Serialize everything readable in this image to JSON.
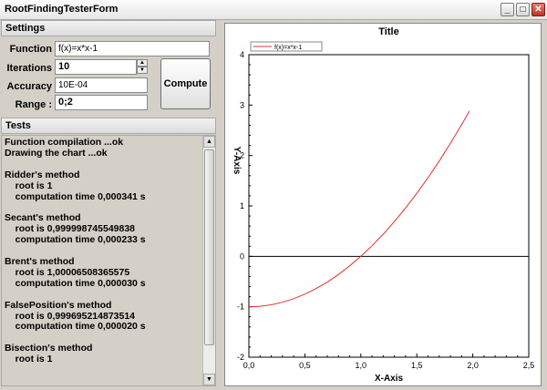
{
  "window": {
    "title": "RootFindingTesterForm",
    "minimize_glyph": "_",
    "maximize_glyph": "□",
    "close_glyph": "✕"
  },
  "settings": {
    "header": "Settings",
    "function_label": "Function",
    "function_value": "f(x)=x*x-1",
    "iterations_label": "Iterations",
    "iterations_value": "10",
    "accuracy_label": "Accuracy",
    "accuracy_value": "10E-04",
    "range_label": "Range :",
    "range_value": "0;2",
    "compute_label": "Compute"
  },
  "tests": {
    "header": "Tests",
    "lines": [
      "Function compilation ...ok",
      "Drawing the chart ...ok",
      "",
      "Ridder's method",
      "    root is 1",
      "    computation time 0,000341 s",
      "",
      "Secant's method",
      "    root is 0,999998745549838",
      "    computation time 0,000233 s",
      "",
      "Brent's method",
      "    root is 1,00006508365575",
      "    computation time 0,000030 s",
      "",
      "FalsePosition's method",
      "    root is 0,999695214873514",
      "    computation time 0,000020 s",
      "",
      "Bisection's method",
      "    root is 1"
    ]
  },
  "chart_data": {
    "type": "line",
    "title": "Title",
    "xlabel": "X-Axis",
    "ylabel": "Y-Axis",
    "xlim": [
      0,
      2.5
    ],
    "ylim": [
      -2,
      4
    ],
    "xticks": [
      "0,0",
      "0,5",
      "1,0",
      "1,5",
      "2,0",
      "2,5"
    ],
    "yticks": [
      "-2",
      "-1",
      "0",
      "1",
      "2",
      "3",
      "4"
    ],
    "legend": "top-left",
    "grid": false,
    "series": [
      {
        "name": "f(x)=x*x-1",
        "color": "#e03030",
        "x": [
          0,
          0.1,
          0.2,
          0.3,
          0.4,
          0.5,
          0.6,
          0.7,
          0.8,
          0.9,
          1.0,
          1.1,
          1.2,
          1.3,
          1.4,
          1.5,
          1.6,
          1.7,
          1.8,
          1.9,
          1.97
        ],
        "y": [
          -1,
          -0.99,
          -0.96,
          -0.91,
          -0.84,
          -0.75,
          -0.64,
          -0.51,
          -0.36,
          -0.19,
          0,
          0.21,
          0.44,
          0.69,
          0.96,
          1.25,
          1.56,
          1.89,
          2.24,
          2.61,
          2.88
        ]
      }
    ],
    "zero_line": 0
  }
}
